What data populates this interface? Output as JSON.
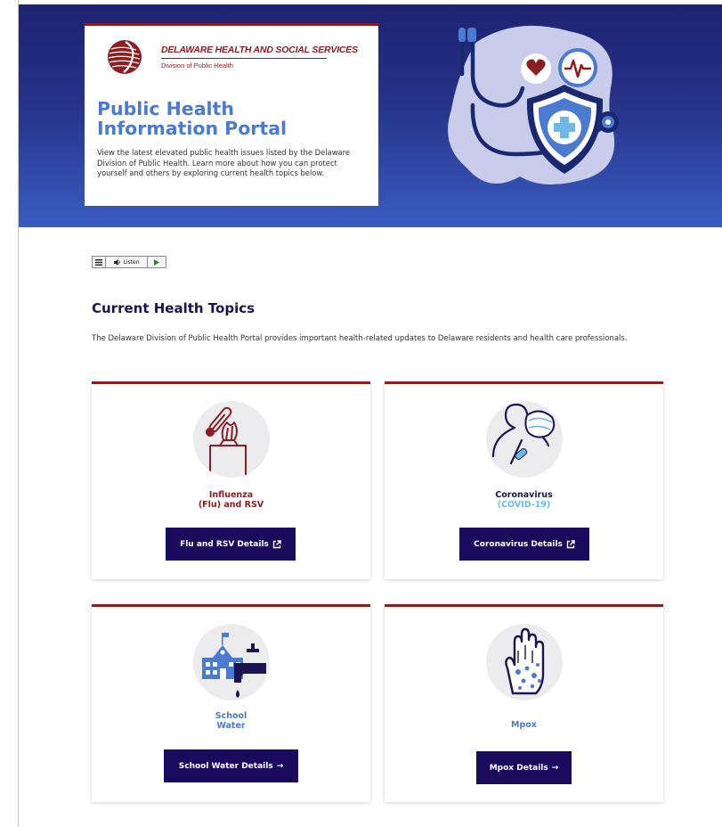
{
  "hero": {
    "agency_name": "DELAWARE HEALTH AND SOCIAL SERVICES",
    "agency_division": "Division of Public Health",
    "title_line1": "Public Health",
    "title_line2": "Information Portal",
    "description": "View the latest elevated public health issues listed by the Delaware Division of Public Health. Learn more about how you can protect yourself and others by exploring current health topics below."
  },
  "listen_toolbar": {
    "menu_icon": "menu-icon",
    "listen_label": "Listen",
    "play_icon": "play-icon"
  },
  "section": {
    "title": "Current Health Topics",
    "description": "The Delaware Division of Public Health Portal provides important health-related updates to Delaware residents and health care professionals."
  },
  "cards": [
    {
      "title_line1": "Influenza",
      "title_line2": "(Flu) and RSV",
      "button_label": "Flu and RSV Details",
      "button_icon": "external-link-icon",
      "icon": "thermometer-tissue-icon"
    },
    {
      "title_line1": "Coronavirus",
      "title_line2": "(COVID-19)",
      "button_label": "Coronavirus Details",
      "button_icon": "external-link-icon",
      "icon": "masked-person-icon"
    },
    {
      "title_line1": "School",
      "title_line2": "Water",
      "button_label": "School Water Details",
      "button_icon": "arrow-right-icon",
      "icon": "school-faucet-icon"
    },
    {
      "title_line1": "Mpox",
      "title_line2": "",
      "button_label": "Mpox Details",
      "button_icon": "arrow-right-icon",
      "icon": "hand-rash-icon"
    }
  ],
  "colors": {
    "hero_gradient_top": "#1e2270",
    "hero_gradient_bottom": "#3a5cc0",
    "accent_maroon": "#8c1e22",
    "button_navy": "#1a0a5e",
    "title_blue": "#4a7bd0",
    "heading_navy": "#1a1450"
  }
}
